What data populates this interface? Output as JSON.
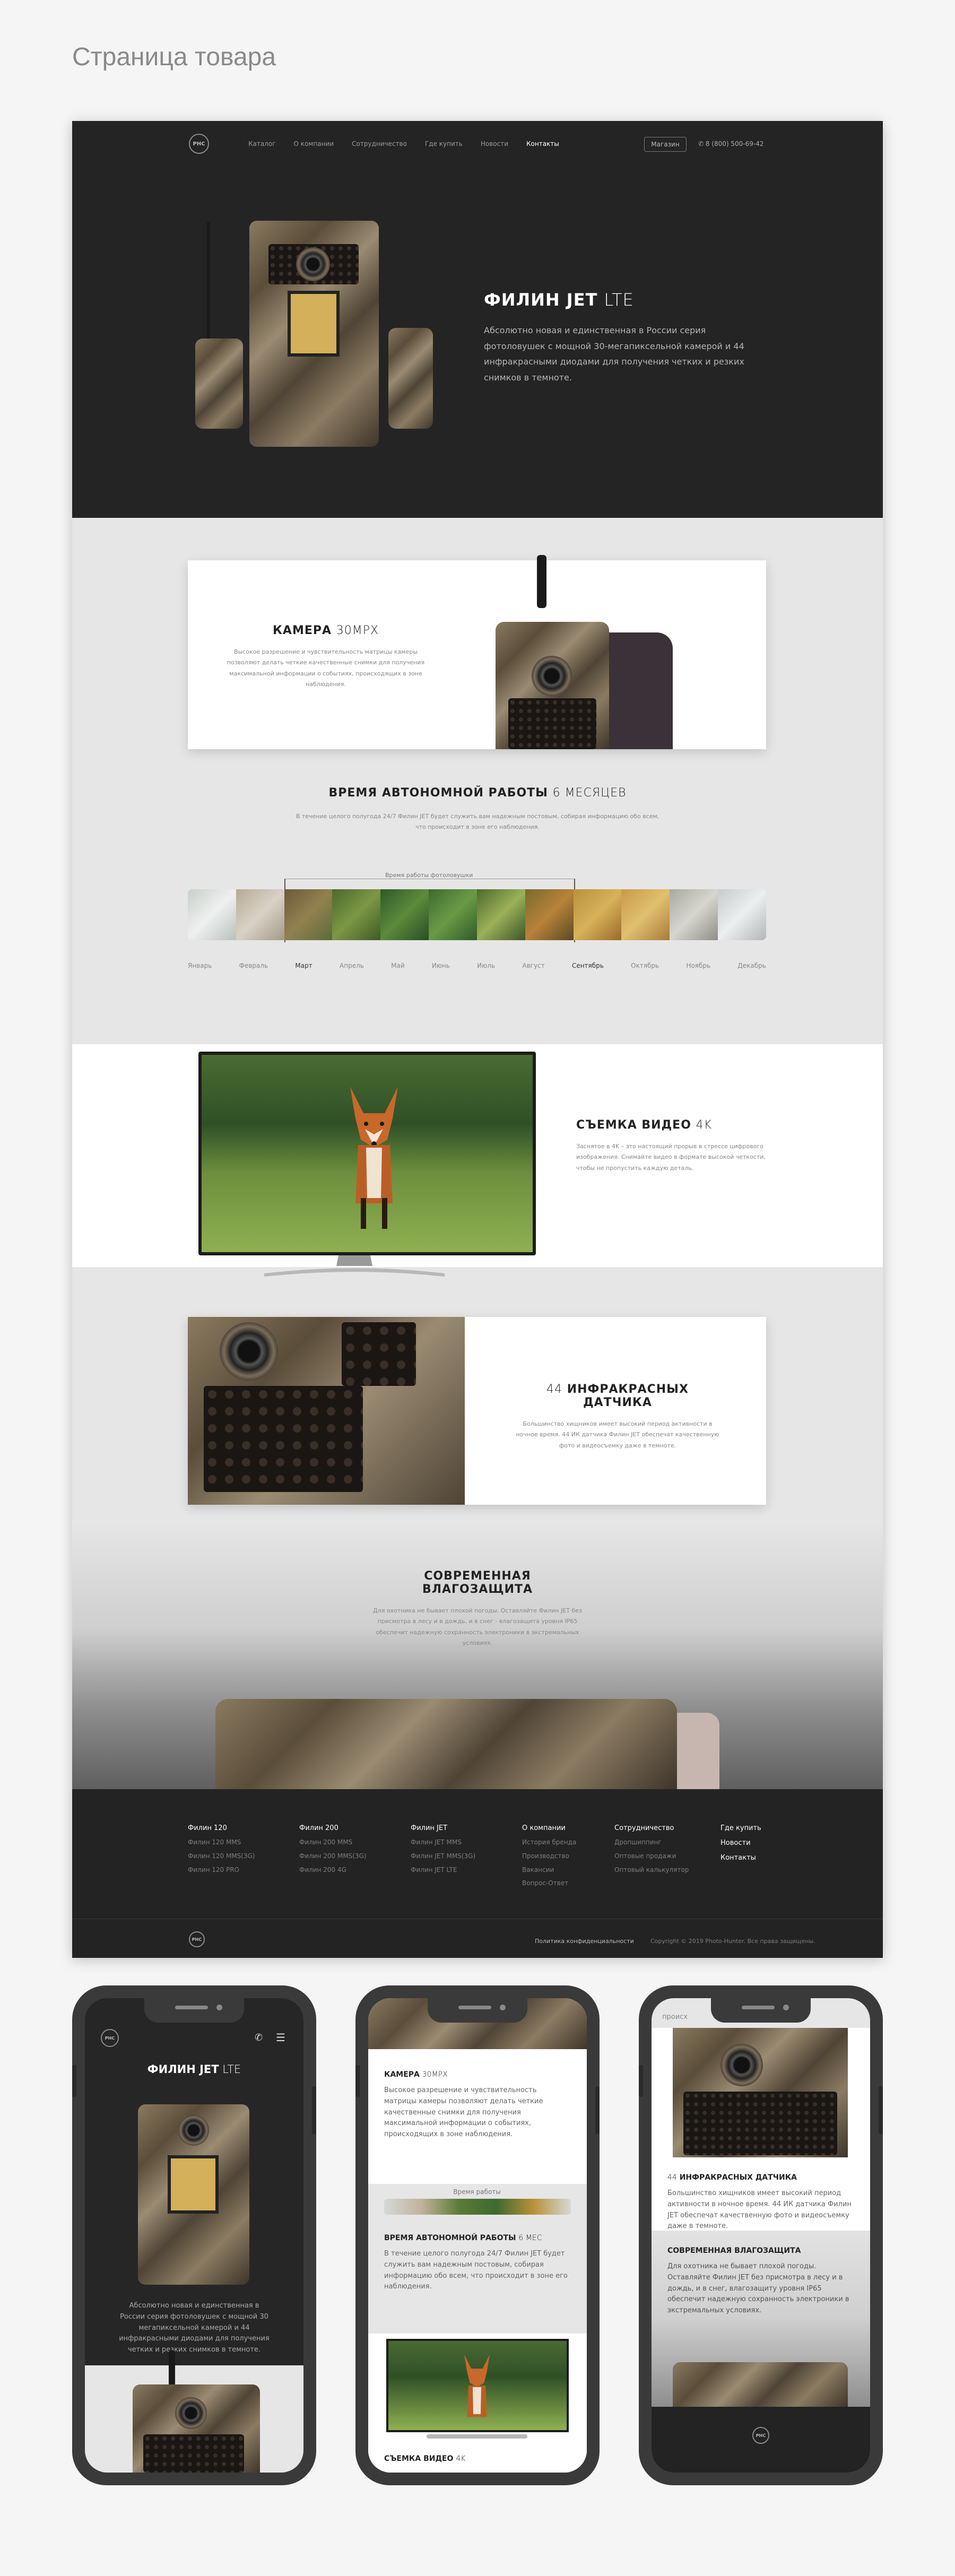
{
  "page_title": "Страница товара",
  "nav": {
    "logo": "PHC",
    "links": [
      "Каталог",
      "О компании",
      "Сотрудничество",
      "Где купить",
      "Новости",
      "Контакты"
    ],
    "shop_button": "Магазин",
    "phone": "8 (800) 500-69-42"
  },
  "hero": {
    "title_bold": "ФИЛИН JET",
    "title_light": "LTE",
    "description": "Абсолютно новая и единственная в России серия фотоловушек с мощной 30-мегапиксельной камерой и 44 инфракрасными диодами для получения четких и резких снимков в темноте."
  },
  "camera_section": {
    "title_bold": "КАМЕРА",
    "title_light": "30MPX",
    "description": "Высокое разрешение и чувствительность матрицы камеры позволяют делать четкие качественные снимки для получения максимальной информации о событиях, происходящих в зоне наблюдения."
  },
  "autonomy_section": {
    "title_bold": "ВРЕМЯ АВТОНОМНОЙ РАБОТЫ",
    "title_light": "6 МЕСЯЦЕВ",
    "description": "В течение целого полугода 24/7 Филин JET будет служить вам надежным постовым, собирая информацию обо всем, что происходит в зоне его наблюдения.",
    "timeline_label": "Время работы фотоловушки",
    "months": [
      "Январь",
      "Февраль",
      "Март",
      "Апрель",
      "Май",
      "Июнь",
      "Июль",
      "Август",
      "Сентябрь",
      "Октябрь",
      "Ноябрь",
      "Декабрь"
    ]
  },
  "video_section": {
    "title_bold": "СЪЕМКА ВИДЕО",
    "title_light": "4K",
    "description": "Заснятое в 4K – это настоящий прорыв в стрессе цифрового изображения. Снимайте видео в формате высокой четкости, чтобы не пропустить каждую деталь."
  },
  "ir_section": {
    "title_light": "44",
    "title_bold": "ИНФРАКРАСНЫХ ДАТЧИКА",
    "description": "Большинство хищников имеет высокий период активности в ночное время. 44 ИК датчика Филин JET обеспечат качественную фото и видеосъемку даже в темноте."
  },
  "moisture_section": {
    "title": "СОВРЕМЕННАЯ ВЛАГОЗАЩИТА",
    "description": "Для охотника не бывает плохой погоды. Оставляйте Филин JET без присмотра в лесу и в дождь, и в снег - влагозащита уровня IP65 обеспечит надежную сохранность электроники в экстремальных условиях."
  },
  "footer": {
    "columns": [
      {
        "title": "Филин 120",
        "items": [
          "Филин 120 MMS",
          "Филин 120 MMS(3G)",
          "Филин 120 PRO"
        ]
      },
      {
        "title": "Филин 200",
        "items": [
          "Филин 200 MMS",
          "Филин 200 MMS(3G)",
          "Филин 200 4G"
        ]
      },
      {
        "title": "Филин JET",
        "items": [
          "Филин JET MMS",
          "Филин JET MMS(3G)",
          "Филин JET LTE"
        ]
      },
      {
        "title": "О компании",
        "items": [
          "История бренда",
          "Производство",
          "Вакансии",
          "Вопрос-Ответ"
        ]
      },
      {
        "title": "Сотрудничество",
        "items": [
          "Дропшиппинг",
          "Оптовые продажи",
          "Оптовый калькулятор"
        ]
      },
      {
        "title": "Где купить",
        "items": [
          "Новости",
          "Контакты"
        ]
      }
    ],
    "privacy": "Политика конфиденциальности",
    "copyright": "Copyright © 2019 Photo-Hunter. Все права защищены."
  },
  "mobile1": {
    "title_bold": "ФИЛИН JET",
    "title_light": "LTE",
    "description": "Абсолютно новая и единственная в России серия фотоловушек с мощной 30 мегапиксельной камерой и 44 инфракрасными диодами для получения четких и резких снимков в темноте."
  },
  "mobile2": {
    "cam_bold": "КАМЕРА",
    "cam_light": "30MPX",
    "cam_desc": "Высокое разрешение и чувствительность матрицы камеры позволяют делать четкие качественные снимки для получения максимальной информации о событиях, происходящих в зоне наблюдения.",
    "timeline_label": "Время работы",
    "auto_bold": "ВРЕМЯ АВТОНОМНОЙ РАБОТЫ",
    "auto_light": "6 МЕС",
    "auto_desc": "В течение целого полугода 24/7 Филин JET будет служить вам надежным постовым, собирая информацию обо всем, что происходит в зоне его наблюдения.",
    "video_bold": "СЪЕМКА ВИДЕО",
    "video_light": "4K"
  },
  "mobile3": {
    "top_text": "происх",
    "ir_light": "44",
    "ir_bold": "ИНФРАКРАСНЫХ ДАТЧИКА",
    "ir_desc": "Большинство хищников имеет высокий период активности в ночное время. 44 ИК датчика Филин JET обеспечат качественную фото и видеосъемку даже в темноте.",
    "moist_title": "СОВРЕМЕННАЯ ВЛАГОЗАЩИТА",
    "moist_desc": "Для охотника не бывает плохой погоды. Оставляйте Филин JET без присмотра в лесу и в дождь, и в снег, влагозащиту уровня IP65 обеспечит надежную сохранность электроники в экстремальных условиях.",
    "logo": "PHC"
  }
}
